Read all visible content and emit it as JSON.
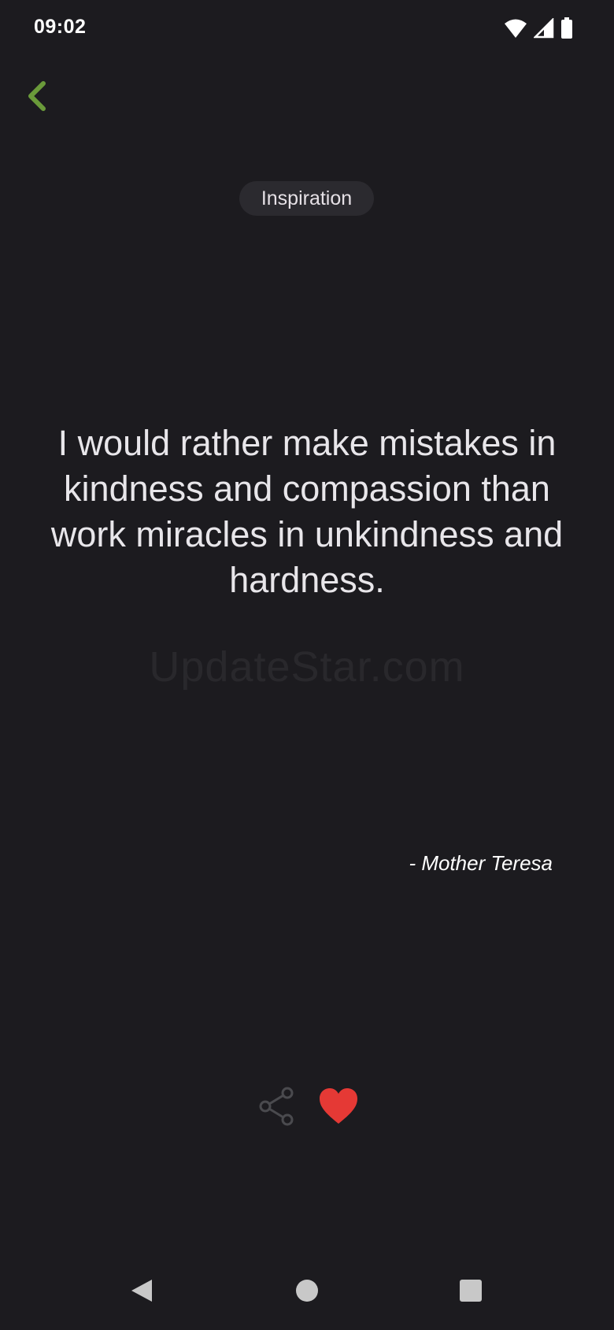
{
  "status_bar": {
    "time": "09:02",
    "icons": [
      "wifi-icon",
      "cell-signal-icon",
      "battery-icon"
    ]
  },
  "header": {
    "back_icon": "chevron-left-icon",
    "accent_color": "#6a9a3a"
  },
  "quote": {
    "category": "Inspiration",
    "text": "I would rather make mistakes in kindness and compassion than work miracles in unkindness and hardness.",
    "author": "- Mother Teresa",
    "watermark": "UpdateStar.com"
  },
  "actions": {
    "share_icon": "share-icon",
    "favorite_icon": "heart-icon",
    "favorite_color": "#e53935",
    "favorited": true
  },
  "nav_bar": {
    "icons": [
      "nav-back-icon",
      "nav-home-icon",
      "nav-recents-icon"
    ]
  }
}
